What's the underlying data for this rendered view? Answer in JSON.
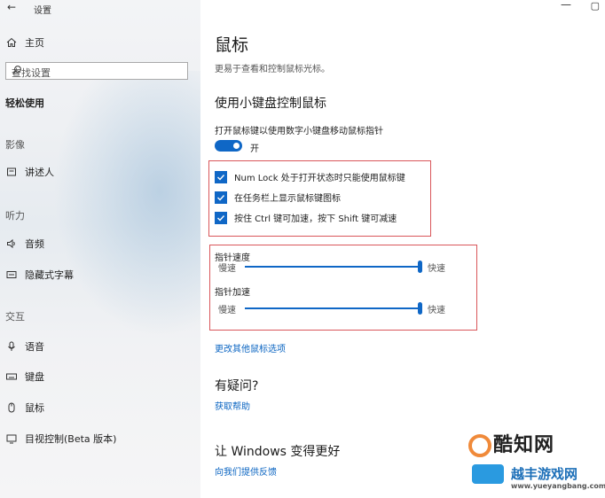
{
  "app": {
    "title": "设置"
  },
  "sidebar": {
    "home": "主页",
    "search_placeholder": "查找设置",
    "section": "轻松使用",
    "groups": [
      {
        "label": "影像",
        "items": [
          {
            "icon": "narrator-icon",
            "label": "讲述人"
          }
        ]
      },
      {
        "label": "听力",
        "items": [
          {
            "icon": "speaker-icon",
            "label": "音频"
          },
          {
            "icon": "caption-icon",
            "label": "隐藏式字幕"
          }
        ]
      },
      {
        "label": "交互",
        "items": [
          {
            "icon": "microphone-icon",
            "label": "语音"
          },
          {
            "icon": "keyboard-icon",
            "label": "键盘"
          },
          {
            "icon": "mouse-icon",
            "label": "鼠标"
          },
          {
            "icon": "eye-control-icon",
            "label": "目视控制(Beta 版本)"
          }
        ]
      }
    ]
  },
  "main": {
    "title": "鼠标",
    "description": "更易于查看和控制鼠标光标。",
    "section_title": "使用小键盘控制鼠标",
    "toggle_label": "打开鼠标键以使用数字小键盘移动鼠标指针",
    "toggle_state": "开",
    "checkboxes": [
      {
        "label": "Num Lock 处于打开状态时只能使用鼠标键",
        "checked": true
      },
      {
        "label": "在任务栏上显示鼠标键图标",
        "checked": true
      },
      {
        "label": "按住 Ctrl 键可加速，按下 Shift 键可减速",
        "checked": true
      }
    ],
    "sliders": [
      {
        "label": "指针速度",
        "min_label": "慢速",
        "max_label": "快速",
        "value_fraction": 1.0
      },
      {
        "label": "指针加速",
        "min_label": "慢速",
        "max_label": "快速",
        "value_fraction": 1.0
      }
    ],
    "more_link": "更改其他鼠标选项",
    "help_title": "有疑问?",
    "help_link": "获取帮助",
    "improve_title": "让 Windows 变得更好",
    "feedback_link": "向我们提供反馈"
  },
  "watermark": {
    "brand": "酷知网",
    "brand2": "越丰游戏网",
    "url": "www.yueyangbang.com"
  },
  "colors": {
    "accent": "#0f67c6",
    "link": "#0b65c2",
    "highlight_box": "#d9565a"
  }
}
